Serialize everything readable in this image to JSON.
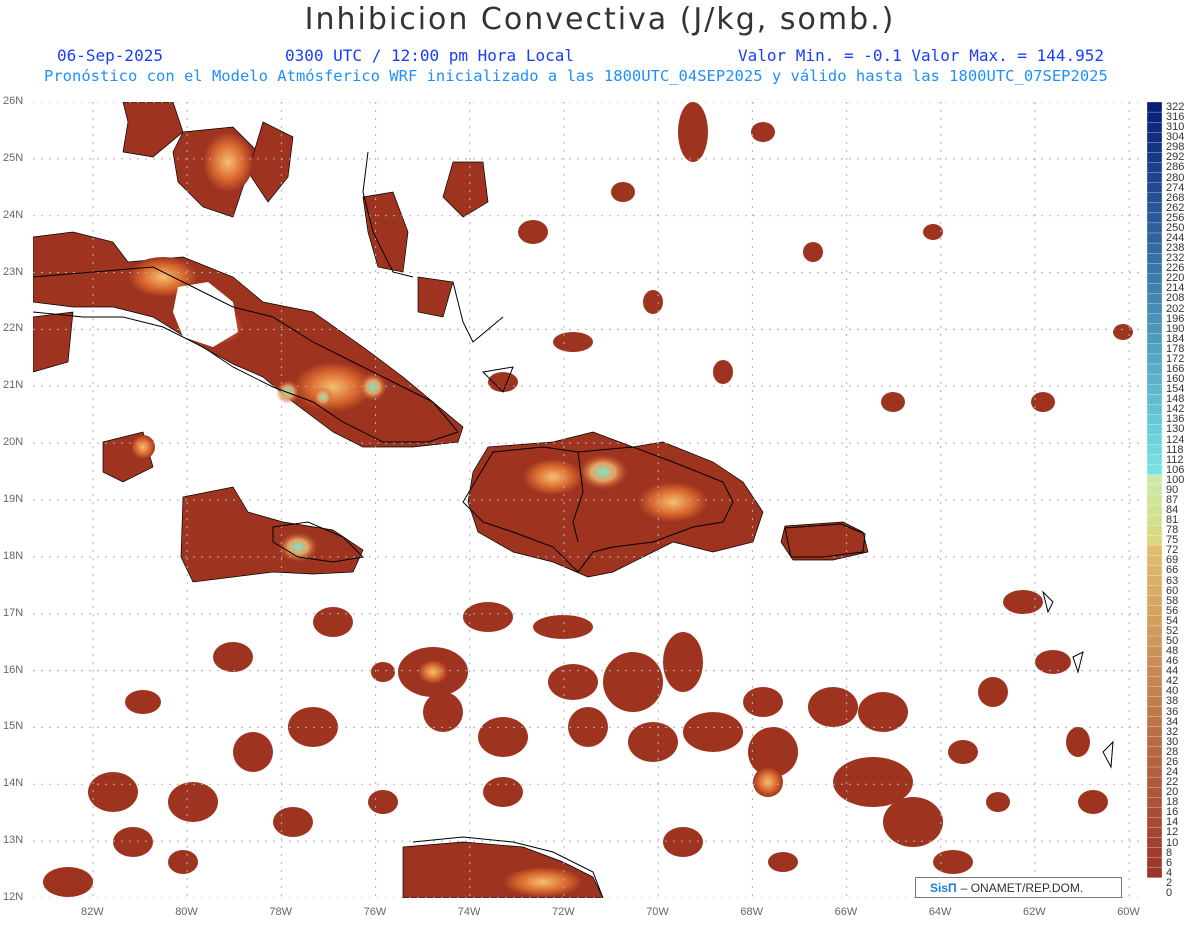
{
  "header": {
    "title": "Inhibicion Convectiva (J/kg, somb.)",
    "date": "06-Sep-2025",
    "time": "0300 UTC / 12:00 pm Hora Local",
    "minmax": "Valor Min. = -0.1  Valor Max. = 144.952",
    "model_line": "Pronóstico con el Modelo Atmósferico WRF inicializado a las 1800UTC_04SEP2025 y válido hasta las  1800UTC_07SEP2025"
  },
  "map": {
    "lat_labels": [
      "26N",
      "25N",
      "24N",
      "23N",
      "22N",
      "21N",
      "20N",
      "19N",
      "18N",
      "17N",
      "16N",
      "15N",
      "14N",
      "13N",
      "12N"
    ],
    "lon_labels": [
      "82W",
      "80W",
      "78W",
      "76W",
      "74W",
      "72W",
      "70W",
      "68W",
      "66W",
      "64W",
      "62W",
      "60W"
    ],
    "fill_color": "#9e3420",
    "highlight_colors": [
      "#e0783a",
      "#f0a050",
      "#7fe6c9"
    ]
  },
  "colorbar": {
    "labels": [
      "322",
      "316",
      "310",
      "304",
      "298",
      "292",
      "286",
      "280",
      "274",
      "268",
      "262",
      "256",
      "250",
      "244",
      "238",
      "232",
      "226",
      "220",
      "214",
      "208",
      "202",
      "196",
      "190",
      "184",
      "178",
      "172",
      "166",
      "160",
      "154",
      "148",
      "142",
      "136",
      "130",
      "124",
      "118",
      "112",
      "106",
      "100",
      "90",
      "87",
      "84",
      "81",
      "78",
      "75",
      "72",
      "69",
      "66",
      "63",
      "60",
      "58",
      "56",
      "54",
      "52",
      "50",
      "48",
      "46",
      "44",
      "42",
      "40",
      "38",
      "36",
      "34",
      "32",
      "30",
      "28",
      "26",
      "24",
      "22",
      "20",
      "18",
      "16",
      "14",
      "12",
      "10",
      "8",
      "6",
      "4",
      "2",
      "0"
    ]
  },
  "credit": {
    "brand": "SisΠ",
    "text": "– ONAMET/REP.DOM."
  }
}
